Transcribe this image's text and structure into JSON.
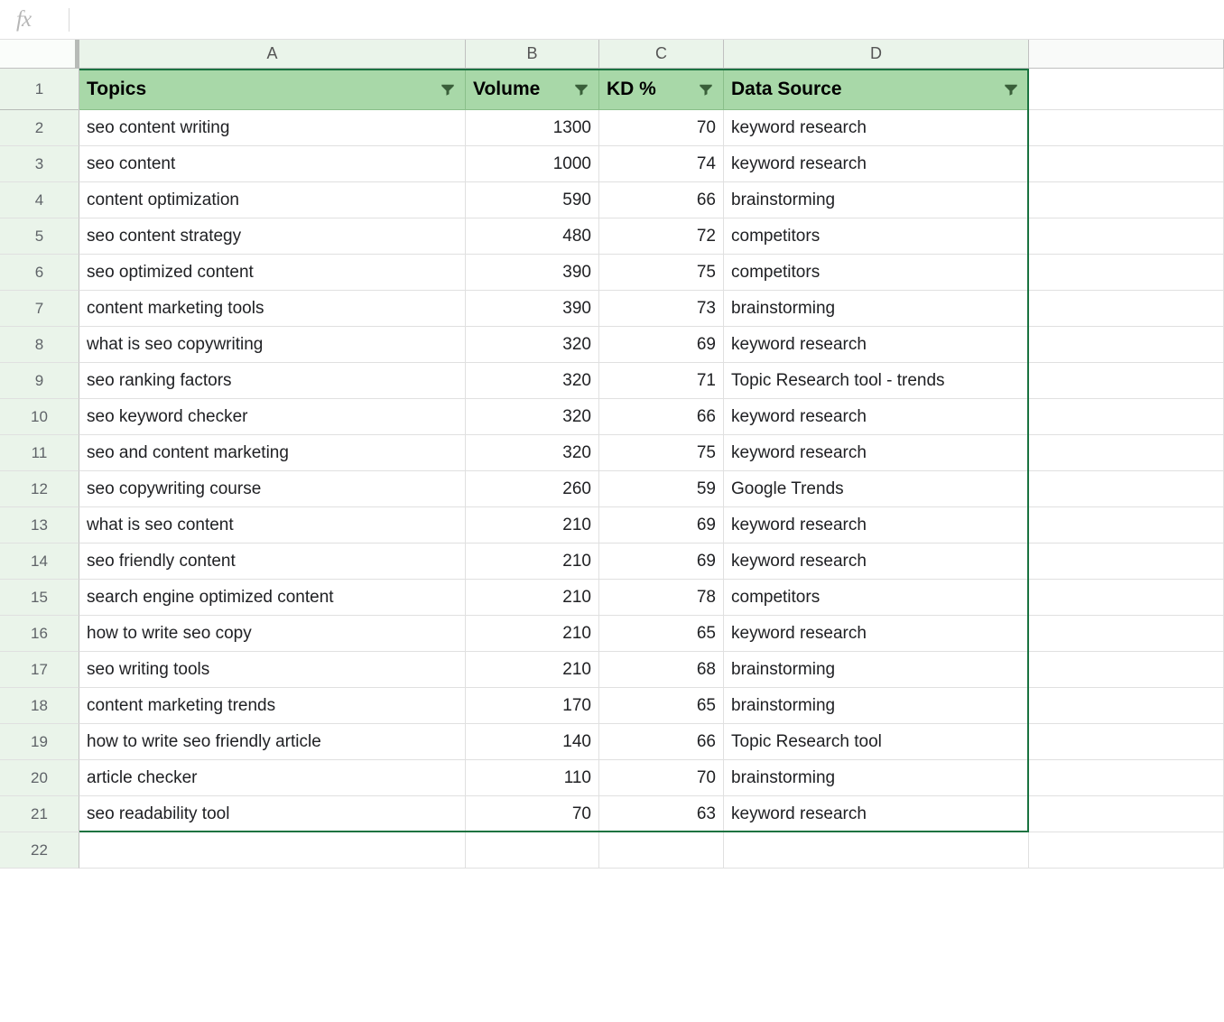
{
  "formula_bar": {
    "fx_label": "fx",
    "value": ""
  },
  "columns": [
    "A",
    "B",
    "C",
    "D"
  ],
  "extra_column_label": "",
  "headers": {
    "a": "Topics",
    "b": "Volume",
    "c": "KD %",
    "d": "Data Source"
  },
  "row_numbers": [
    1,
    2,
    3,
    4,
    5,
    6,
    7,
    8,
    9,
    10,
    11,
    12,
    13,
    14,
    15,
    16,
    17,
    18,
    19,
    20,
    21,
    22
  ],
  "rows": [
    {
      "topic": "seo content writing",
      "volume": 1300,
      "kd": 70,
      "source": "keyword research"
    },
    {
      "topic": "seo content",
      "volume": 1000,
      "kd": 74,
      "source": "keyword research"
    },
    {
      "topic": "content optimization",
      "volume": 590,
      "kd": 66,
      "source": "brainstorming"
    },
    {
      "topic": "seo content strategy",
      "volume": 480,
      "kd": 72,
      "source": "competitors"
    },
    {
      "topic": "seo optimized content",
      "volume": 390,
      "kd": 75,
      "source": "competitors"
    },
    {
      "topic": "content marketing tools",
      "volume": 390,
      "kd": 73,
      "source": "brainstorming"
    },
    {
      "topic": "what is seo copywriting",
      "volume": 320,
      "kd": 69,
      "source": "keyword research"
    },
    {
      "topic": "seo ranking factors",
      "volume": 320,
      "kd": 71,
      "source": "Topic Research tool - trends"
    },
    {
      "topic": "seo keyword checker",
      "volume": 320,
      "kd": 66,
      "source": "keyword research"
    },
    {
      "topic": "seo and content marketing",
      "volume": 320,
      "kd": 75,
      "source": "keyword research"
    },
    {
      "topic": "seo copywriting course",
      "volume": 260,
      "kd": 59,
      "source": "Google Trends"
    },
    {
      "topic": "what is seo content",
      "volume": 210,
      "kd": 69,
      "source": "keyword research"
    },
    {
      "topic": "seo friendly content",
      "volume": 210,
      "kd": 69,
      "source": "keyword research"
    },
    {
      "topic": "search engine optimized content",
      "volume": 210,
      "kd": 78,
      "source": "competitors"
    },
    {
      "topic": "how to write seo copy",
      "volume": 210,
      "kd": 65,
      "source": "keyword research"
    },
    {
      "topic": "seo writing tools",
      "volume": 210,
      "kd": 68,
      "source": "brainstorming"
    },
    {
      "topic": "content marketing trends",
      "volume": 170,
      "kd": 65,
      "source": "brainstorming"
    },
    {
      "topic": "how to write seo friendly article",
      "volume": 140,
      "kd": 66,
      "source": "Topic Research tool"
    },
    {
      "topic": "article checker",
      "volume": 110,
      "kd": 70,
      "source": "brainstorming"
    },
    {
      "topic": "seo readability tool",
      "volume": 70,
      "kd": 63,
      "source": "keyword research"
    }
  ]
}
